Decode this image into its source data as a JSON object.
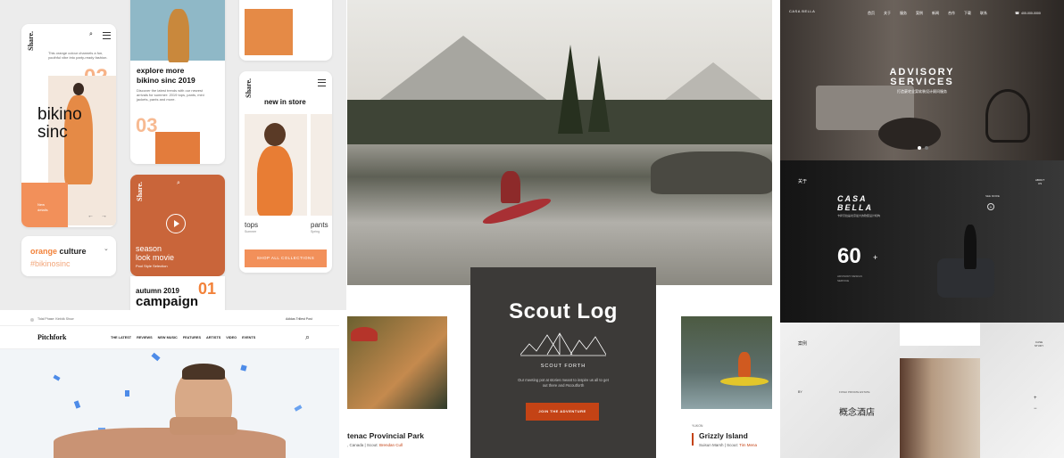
{
  "panel1": {
    "brand": "Share.",
    "phone1": {
      "num": "02",
      "blurb": "This orange colour channels a fun, youthful vibe into party-ready fashion.",
      "headline_line1": "bikino",
      "headline_line2": "sinc",
      "tile_line1": "New",
      "tile_line2": "details"
    },
    "card_orange": {
      "word1": "orange",
      "word2": "culture",
      "tag": "#bikinosinc"
    },
    "phone2": {
      "title_line1": "explore more",
      "title_line2": "bikino sinc 2019",
      "text": "Discover the latest trends with our newest arrivals for summer: 2019 tops, pants, mini jackets, pants and more.",
      "num": "03"
    },
    "phone3": {
      "line1": "season",
      "line2": "look movie",
      "caption": "Pool Style Selection",
      "num": "01"
    },
    "bottom_card": {
      "line1": "autumn 2019",
      "line2": "campaign"
    },
    "phone4": {
      "title": "new in store",
      "item1": "tops",
      "item1_sub": "Summer",
      "item2": "pants",
      "item2_sub": "Spring",
      "cta": "SHOP ALL COLLECTIONS"
    }
  },
  "panel2": {
    "top_left": "Tidal Phase: Kinfolk Show",
    "top_right": "Adidas Trillest Post",
    "logo": "Pitchfork",
    "nav": [
      "THE LATEST",
      "REVIEWS",
      "NEW MUSIC",
      "FEATURES",
      "ARTISTS",
      "VIDEO",
      "EVENTS"
    ]
  },
  "panel3": {
    "title": "Scout Log",
    "subtitle": "SCOUT FORTH",
    "desc": "Our meeting pot at stories meant to inspire us all to get out there and #scoutforth",
    "cta": "JOIN THE ADVENTURE",
    "left_title": "tenac Provincial Park",
    "left_meta_prefix": ", Canada | Scout:",
    "left_meta_name": "Brendan Cull",
    "right_label": "YUKON",
    "right_title": "Grizzly Island",
    "right_meta_prefix": "Suisun Marsh | Scout:",
    "right_meta_name": "Tim Mena"
  },
  "panel4": {
    "brand": "CASA BELLA",
    "nav": [
      "首页",
      "关于",
      "服务",
      "案例",
      "新闻",
      "合作",
      "下载",
      "联系"
    ],
    "phone": "400-000-0000",
    "hero_title_line1": "ADVISORY",
    "hero_title_line2": "SERVICES",
    "hero_sub": "打造豪宅全案软装设计顾问服务",
    "about_label": "关于",
    "about_right": "ABOUT US",
    "casa_line1": "CASA",
    "casa_line2": "BELLA",
    "casa_sub": "卡萨贝拉是北京最大的软装设计机构",
    "see_more": "SEE MORE",
    "stat_num": "60",
    "stat_plus": "+",
    "stat_caption": "ADVISORY DESIGN SERVICE",
    "case_label": "案例",
    "case_right": "CASE STUDY",
    "by_label": "BY",
    "hotel_meta": "FOSHI PRIVATE ESTATE",
    "hotel_name": "概念酒店"
  },
  "colors": {
    "orange": "#f2823a",
    "scout_dark": "#3c3a38",
    "scout_btn": "#c44315"
  }
}
